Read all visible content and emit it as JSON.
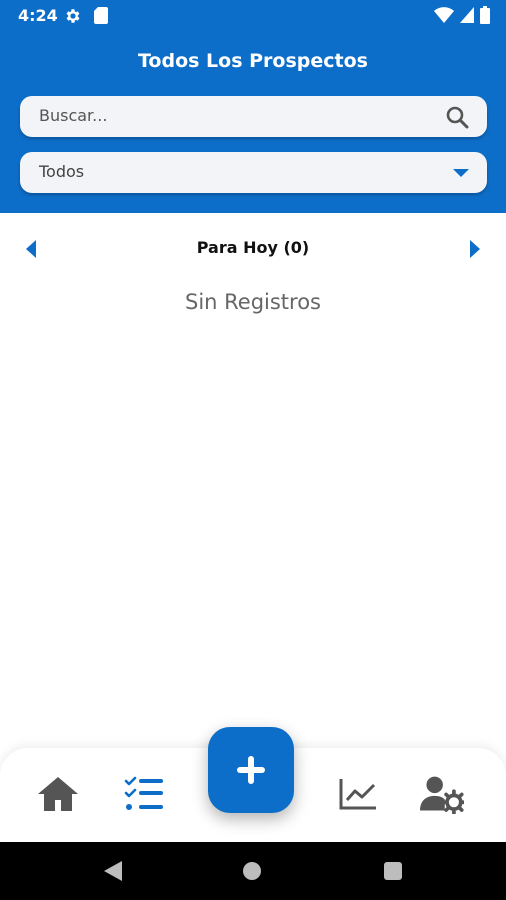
{
  "status_bar": {
    "time": "4:24",
    "icons": [
      "gear-icon",
      "sd-card-icon",
      "wifi-icon",
      "signal-icon",
      "battery-icon"
    ]
  },
  "header": {
    "title": "Todos Los Prospectos"
  },
  "search": {
    "placeholder": "Buscar..."
  },
  "filter": {
    "selected": "Todos"
  },
  "day_nav": {
    "title": "Para Hoy (0)"
  },
  "list": {
    "empty_text": "Sin Registros"
  },
  "bottom_nav": {
    "items": [
      {
        "icon": "home-icon",
        "active": false
      },
      {
        "icon": "checklist-icon",
        "active": true
      },
      {
        "icon": "chart-line-icon",
        "active": false
      },
      {
        "icon": "user-settings-icon",
        "active": false
      }
    ],
    "fab_icon": "plus-icon"
  },
  "colors": {
    "primary": "#0d6ec9",
    "inactive_icon": "#555555",
    "field_bg": "#f2f4f7"
  }
}
